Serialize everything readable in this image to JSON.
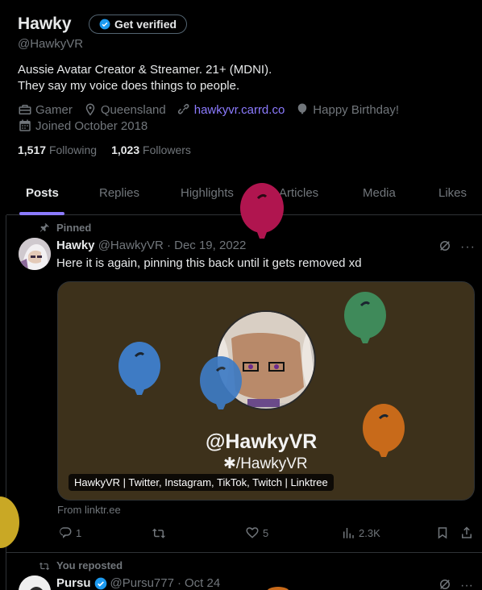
{
  "profile": {
    "name": "Hawky",
    "verify_label": "Get verified",
    "handle": "@HawkyVR",
    "bio_lines": [
      "Aussie Avatar Creator & Streamer. 21+ (MDNI).",
      "They say my voice does things to people."
    ],
    "category": "Gamer",
    "location": "Queensland",
    "website": "hawkyvr.carrd.co",
    "birthday": "Happy Birthday!",
    "joined": "Joined October 2018",
    "following_count": "1,517",
    "following_label": "Following",
    "followers_count": "1,023",
    "followers_label": "Followers"
  },
  "tabs": [
    {
      "label": "Posts",
      "active": true
    },
    {
      "label": "Replies",
      "active": false
    },
    {
      "label": "Highlights",
      "active": false
    },
    {
      "label": "Articles",
      "active": false
    },
    {
      "label": "Media",
      "active": false
    },
    {
      "label": "Likes",
      "active": false
    }
  ],
  "pinned_post": {
    "pinned_label": "Pinned",
    "author_name": "Hawky",
    "author_handle": "@HawkyVR",
    "dot": "·",
    "date": "Dec 19, 2022",
    "text": "Here it is again, pinning this back until it gets removed xd",
    "card": {
      "title": "@HawkyVR",
      "subtitle": "✱/HawkyVR",
      "caption": "HawkyVR | Twitter, Instagram, TikTok, Twitch | Linktree"
    },
    "from": "From linktr.ee",
    "replies": "1",
    "reposts": "",
    "likes": "5",
    "views": "2.3K"
  },
  "second_post": {
    "repost_label": "You reposted",
    "author_name": "Pursu",
    "author_handle": "@Pursu777",
    "dot": "·",
    "date": "Oct 24"
  },
  "colors": {
    "accent": "#8c7bff",
    "verified": "#1d9bf0",
    "background": "#000000",
    "balloon_magenta": "#b0154f",
    "balloon_blue": "#3e7bc4",
    "balloon_green": "#3f8a5a",
    "balloon_orange": "#c86a1a",
    "balloon_yellow": "#c9a825"
  }
}
